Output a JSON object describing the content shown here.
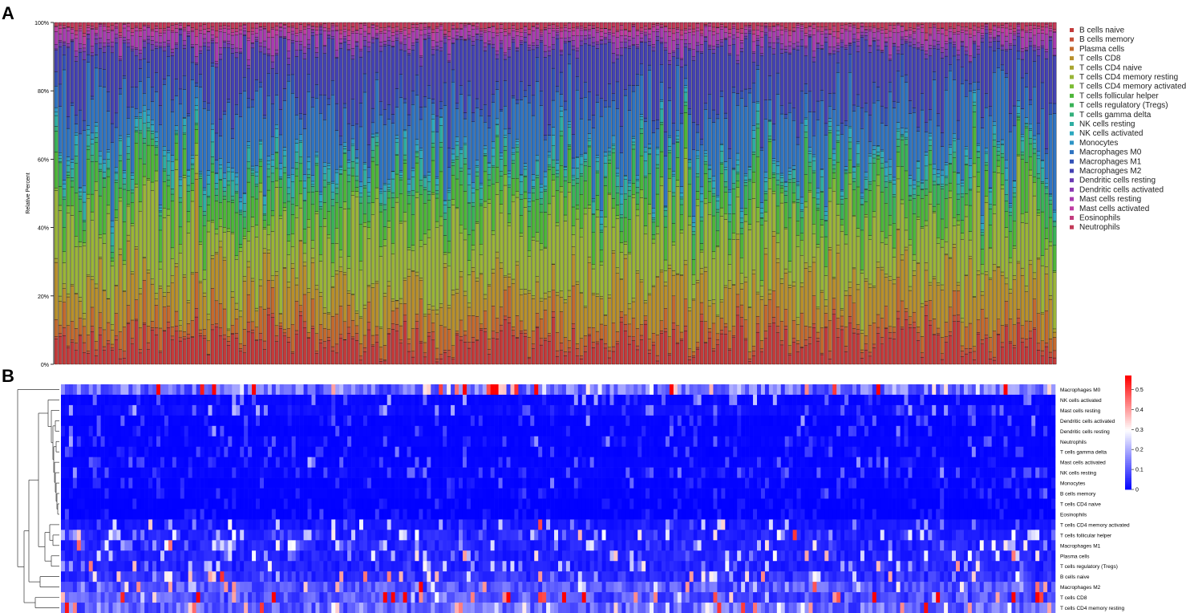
{
  "panels": {
    "a_label": "A",
    "b_label": "B"
  },
  "chart_data": [
    {
      "type": "bar",
      "stacked": true,
      "ylabel": "Relative Percent",
      "ylim": [
        0,
        1
      ],
      "yticks": [
        {
          "value": 0,
          "label": "0%"
        },
        {
          "value": 0.2,
          "label": "20%"
        },
        {
          "value": 0.4,
          "label": "40%"
        },
        {
          "value": 0.6,
          "label": "60%"
        },
        {
          "value": 0.8,
          "label": "80%"
        },
        {
          "value": 1,
          "label": "100%"
        }
      ],
      "sample_count": 250,
      "legend_position": "right",
      "series": [
        {
          "name": "B cells naive",
          "color": "#C33B3B",
          "mean": 0.065
        },
        {
          "name": "B cells memory",
          "color": "#C6503A",
          "mean": 0.012
        },
        {
          "name": "Plasma cells",
          "color": "#C46A2E",
          "mean": 0.045
        },
        {
          "name": "T cells CD8",
          "color": "#B8902C",
          "mean": 0.1
        },
        {
          "name": "T cells CD4 naive",
          "color": "#A9A530",
          "mean": 0.01
        },
        {
          "name": "T cells CD4 memory resting",
          "color": "#9AB538",
          "mean": 0.17
        },
        {
          "name": "T cells CD4 memory activated",
          "color": "#7DBC35",
          "mean": 0.02
        },
        {
          "name": "T cells follicular helper",
          "color": "#4EB63A",
          "mean": 0.07
        },
        {
          "name": "T cells regulatory (Tregs)",
          "color": "#3AB358",
          "mean": 0.05
        },
        {
          "name": "T cells gamma delta",
          "color": "#34B07C",
          "mean": 0.01
        },
        {
          "name": "NK cells resting",
          "color": "#2FAEA2",
          "mean": 0.025
        },
        {
          "name": "NK cells activated",
          "color": "#2DA9BF",
          "mean": 0.015
        },
        {
          "name": "Monocytes",
          "color": "#2E95C6",
          "mean": 0.01
        },
        {
          "name": "Macrophages M0",
          "color": "#2F74C2",
          "mean": 0.15
        },
        {
          "name": "Macrophages M1",
          "color": "#3353B8",
          "mean": 0.04
        },
        {
          "name": "Macrophages M2",
          "color": "#4442B3",
          "mean": 0.13
        },
        {
          "name": "Dendritic cells resting",
          "color": "#6B3CB3",
          "mean": 0.01
        },
        {
          "name": "Dendritic cells activated",
          "color": "#8B3AB2",
          "mean": 0.01
        },
        {
          "name": "Mast cells resting",
          "color": "#A83CB0",
          "mean": 0.025
        },
        {
          "name": "Mast cells activated",
          "color": "#BF3CA3",
          "mean": 0.01
        },
        {
          "name": "Eosinophils",
          "color": "#C23C7E",
          "mean": 0.008
        },
        {
          "name": "Neutrophils",
          "color": "#C33B58",
          "mean": 0.012
        }
      ]
    },
    {
      "type": "heatmap",
      "sample_count": 250,
      "rows": [
        {
          "name": "Macrophages M0",
          "mean": 0.16,
          "spread": 0.55
        },
        {
          "name": "NK cells activated",
          "mean": 0.01,
          "spread": 0.2
        },
        {
          "name": "Mast cells resting",
          "mean": 0.02,
          "spread": 0.2
        },
        {
          "name": "Dendritic cells activated",
          "mean": 0.005,
          "spread": 0.12
        },
        {
          "name": "Dendritic cells resting",
          "mean": 0.005,
          "spread": 0.1
        },
        {
          "name": "Neutrophils",
          "mean": 0.008,
          "spread": 0.1
        },
        {
          "name": "T cells gamma delta",
          "mean": 0.005,
          "spread": 0.1
        },
        {
          "name": "Mast cells activated",
          "mean": 0.008,
          "spread": 0.12
        },
        {
          "name": "NK cells resting",
          "mean": 0.01,
          "spread": 0.12
        },
        {
          "name": "Monocytes",
          "mean": 0.005,
          "spread": 0.08
        },
        {
          "name": "B cells memory",
          "mean": 0.005,
          "spread": 0.08
        },
        {
          "name": "T cells CD4 naive",
          "mean": 0.002,
          "spread": 0.05
        },
        {
          "name": "Eosinophils",
          "mean": 0.002,
          "spread": 0.05
        },
        {
          "name": "T cells CD4 memory activated",
          "mean": 0.03,
          "spread": 0.25
        },
        {
          "name": "T cells follicular helper",
          "mean": 0.05,
          "spread": 0.28
        },
        {
          "name": "Macrophages M1",
          "mean": 0.05,
          "spread": 0.28
        },
        {
          "name": "Plasma cells",
          "mean": 0.05,
          "spread": 0.32
        },
        {
          "name": "T cells regulatory (Tregs)",
          "mean": 0.05,
          "spread": 0.28
        },
        {
          "name": "B cells naive",
          "mean": 0.07,
          "spread": 0.38
        },
        {
          "name": "Macrophages M2",
          "mean": 0.12,
          "spread": 0.38
        },
        {
          "name": "T cells CD8",
          "mean": 0.12,
          "spread": 0.55
        },
        {
          "name": "T cells CD4 memory resting",
          "mean": 0.15,
          "spread": 0.42
        }
      ],
      "color_scale": {
        "min": 0,
        "max": 0.57,
        "colors": [
          "#0000FF",
          "#FFFFFF",
          "#FF0000"
        ],
        "ticks": [
          {
            "value": 0,
            "label": "0"
          },
          {
            "value": 0.1,
            "label": "0.1"
          },
          {
            "value": 0.2,
            "label": "0.2"
          },
          {
            "value": 0.3,
            "label": "0.3"
          },
          {
            "value": 0.4,
            "label": "0.4"
          },
          {
            "value": 0.5,
            "label": "0.5"
          }
        ]
      },
      "dendrogram": true
    }
  ]
}
